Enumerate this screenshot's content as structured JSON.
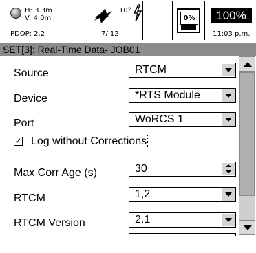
{
  "status": {
    "gps_h": "H: 3.3m",
    "gps_v": "V: 4.0m",
    "pdop": "PDOP: 2.2",
    "tilt": "10°",
    "sats": "7/ 12",
    "memory_pct": "0%",
    "battery_pct": "100%",
    "time": "11:03 p.m."
  },
  "title": "SET[3]: Real-Time Data- JOB01",
  "form": {
    "source": {
      "label": "Source",
      "value": "RTCM"
    },
    "device": {
      "label": "Device",
      "value": "*RTS Module"
    },
    "port": {
      "label": "Port",
      "value": "WoRCS 1"
    },
    "log_without_corrections": {
      "label": "Log without Corrections",
      "checked": true,
      "mark": "✓"
    },
    "max_corr_age": {
      "label": "Max Corr Age (s)",
      "value": "30"
    },
    "rtcm": {
      "label": "RTCM",
      "value": "1,2"
    },
    "rtcm_version": {
      "label": "RTCM Version",
      "value": "2.1"
    }
  }
}
